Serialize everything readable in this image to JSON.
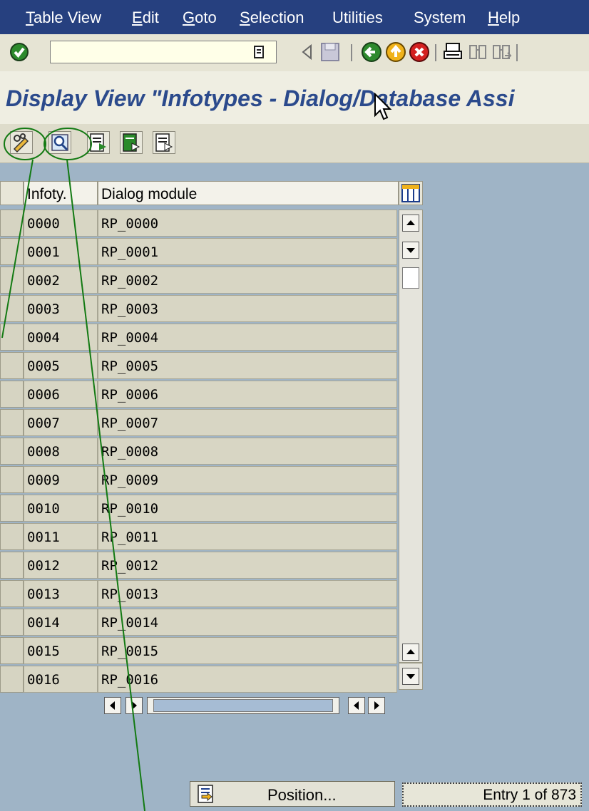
{
  "menu": [
    {
      "label": "Table View",
      "underline": "T",
      "rest": "able View"
    },
    {
      "label": "Edit",
      "underline": "E",
      "rest": "dit"
    },
    {
      "label": "Goto",
      "underline": "G",
      "rest": "oto"
    },
    {
      "label": "Selection",
      "underline": "S",
      "rest": "election"
    },
    {
      "label": "Utilities",
      "underline": "",
      "rest": "Utilities"
    },
    {
      "label": "System",
      "underline": "",
      "rest": "System"
    },
    {
      "label": "Help",
      "underline": "H",
      "rest": "elp"
    }
  ],
  "toolbar": {
    "command_field_value": "",
    "icons": [
      "enter-icon",
      "command-dropdown-icon",
      "back-arrow-icon",
      "save-icon",
      "back-icon",
      "exit-icon",
      "cancel-icon",
      "print-icon",
      "find-icon",
      "find-next-icon"
    ]
  },
  "title": "Display View \"Infotypes - Dialog/Database Assi",
  "app_toolbar": {
    "icons": [
      "display-change-icon",
      "details-icon",
      "select-all-icon",
      "select-block-icon",
      "deselect-all-icon"
    ]
  },
  "table": {
    "headers": {
      "infotype": "Infoty.",
      "dialog_module": "Dialog module"
    },
    "rows": [
      {
        "infotype": "0000",
        "module": "RP_0000"
      },
      {
        "infotype": "0001",
        "module": "RP_0001"
      },
      {
        "infotype": "0002",
        "module": "RP_0002"
      },
      {
        "infotype": "0003",
        "module": "RP_0003"
      },
      {
        "infotype": "0004",
        "module": "RP_0004"
      },
      {
        "infotype": "0005",
        "module": "RP_0005"
      },
      {
        "infotype": "0006",
        "module": "RP_0006"
      },
      {
        "infotype": "0007",
        "module": "RP_0007"
      },
      {
        "infotype": "0008",
        "module": "RP_0008"
      },
      {
        "infotype": "0009",
        "module": "RP_0009"
      },
      {
        "infotype": "0010",
        "module": "RP_0010"
      },
      {
        "infotype": "0011",
        "module": "RP_0011"
      },
      {
        "infotype": "0012",
        "module": "RP_0012"
      },
      {
        "infotype": "0013",
        "module": "RP_0013"
      },
      {
        "infotype": "0014",
        "module": "RP_0014"
      },
      {
        "infotype": "0015",
        "module": "RP_0015"
      },
      {
        "infotype": "0016",
        "module": "RP_0016"
      }
    ]
  },
  "position_button": "Position...",
  "entry_info": "Entry 1 of 873",
  "colors": {
    "menu_bar": "#26407f",
    "title_text": "#2b4a8c",
    "annotation": "#137a13",
    "background": "#9fb4c6"
  }
}
